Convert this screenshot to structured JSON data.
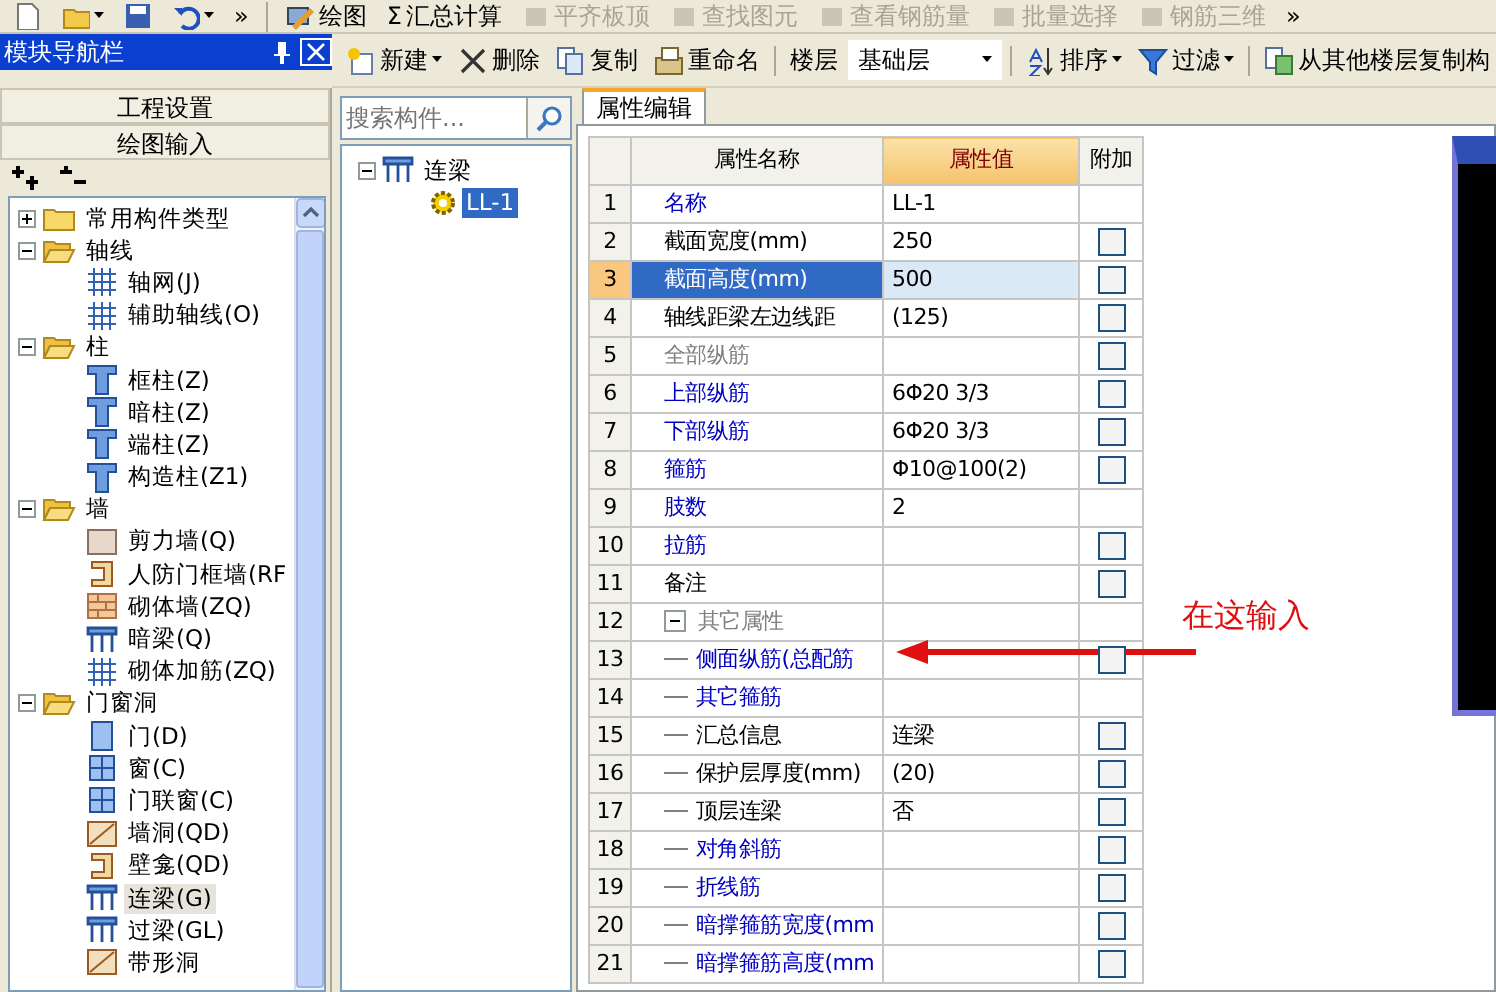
{
  "quick_access": [
    {
      "dropdown": false
    },
    {
      "dropdown": true
    },
    {
      "dropdown": false
    },
    {
      "dropdown": true
    }
  ],
  "quick_overflow": "»",
  "tools": [
    {
      "label": "绘图",
      "disabled": false
    },
    {
      "label": "汇总计算",
      "symbol": "Σ",
      "disabled": false
    },
    {
      "label": "平齐板顶",
      "disabled": true
    },
    {
      "label": "查找图元",
      "disabled": true
    },
    {
      "label": "查看钢筋量",
      "disabled": true
    },
    {
      "label": "批量选择",
      "disabled": true
    },
    {
      "label": "钢筋三维",
      "disabled": true
    }
  ],
  "tools_overflow": "»",
  "nav": {
    "title": "模块导航栏",
    "sections": [
      {
        "label": "工程设置"
      },
      {
        "label": "绘图输入"
      }
    ],
    "tree": [
      {
        "label": "常用构件类型",
        "expanded": false,
        "selected": false
      },
      {
        "label": "轴线",
        "expanded": true,
        "selected": false,
        "children": [
          {
            "label": "轴网(J)",
            "selected": false
          },
          {
            "label": "辅助轴线(O)",
            "selected": false
          }
        ]
      },
      {
        "label": "柱",
        "expanded": true,
        "selected": false,
        "children": [
          {
            "label": "框柱(Z)",
            "selected": false
          },
          {
            "label": "暗柱(Z)",
            "selected": false
          },
          {
            "label": "端柱(Z)",
            "selected": false
          },
          {
            "label": "构造柱(Z1)",
            "selected": false
          }
        ]
      },
      {
        "label": "墙",
        "expanded": true,
        "selected": false,
        "children": [
          {
            "label": "剪力墙(Q)",
            "selected": false
          },
          {
            "label": "人防门框墙(RF",
            "selected": false
          },
          {
            "label": "砌体墙(ZQ)",
            "selected": false
          },
          {
            "label": "暗梁(Q)",
            "selected": false
          },
          {
            "label": "砌体加筋(ZQ)",
            "selected": false
          }
        ]
      },
      {
        "label": "门窗洞",
        "expanded": true,
        "selected": false,
        "children": [
          {
            "label": "门(D)",
            "selected": false
          },
          {
            "label": "窗(C)",
            "selected": false
          },
          {
            "label": "门联窗(C)",
            "selected": false
          },
          {
            "label": "墙洞(QD)",
            "selected": false
          },
          {
            "label": "壁龛(QD)",
            "selected": false
          },
          {
            "label": "连梁(G)",
            "selected": true
          },
          {
            "label": "过梁(GL)",
            "selected": false
          },
          {
            "label": "带形洞",
            "selected": false
          }
        ]
      }
    ]
  },
  "toolbar": {
    "left": [
      {
        "label": "新建",
        "dropdown": true
      },
      {
        "label": "删除",
        "dropdown": false
      },
      {
        "label": "复制",
        "dropdown": false
      },
      {
        "label": "重命名",
        "dropdown": false
      }
    ],
    "floor": {
      "label": "楼层",
      "value": "基础层"
    },
    "right": [
      {
        "label": "排序",
        "dropdown": true
      },
      {
        "label": "过滤",
        "dropdown": true
      },
      {
        "label": "从其他楼层复制构",
        "dropdown": false
      }
    ]
  },
  "components": {
    "search": {
      "placeholder": "搜索构件..."
    },
    "tree": [
      {
        "label": "连梁",
        "expanded": true,
        "selected": false,
        "children": [
          {
            "label": "LL-1",
            "selected": true
          }
        ]
      }
    ]
  },
  "tabs": [
    {
      "label": "属性编辑",
      "selected": true
    }
  ],
  "table": {
    "columns": [
      "属性名称",
      "属性值",
      "附加"
    ],
    "rows": [
      {
        "index": "1",
        "name": "名称",
        "value": "LL-1",
        "color": "#0000c0",
        "selected": false
      },
      {
        "index": "2",
        "name": "截面宽度(mm)",
        "value": "250",
        "color": "#000000",
        "selected": false,
        "checked": false
      },
      {
        "index": "3",
        "name": "截面高度(mm)",
        "value": "500",
        "color": "#ffffff",
        "selected": true,
        "checked": false
      },
      {
        "index": "4",
        "name": "轴线距梁左边线距",
        "value": "(125)",
        "color": "#000000",
        "selected": false,
        "checked": false
      },
      {
        "index": "5",
        "name": "全部纵筋",
        "color": "#808080",
        "selected": false,
        "checked": false
      },
      {
        "index": "6",
        "name": "上部纵筋",
        "value": "6Φ20 3/3",
        "color": "#0000c0",
        "selected": false,
        "checked": false
      },
      {
        "index": "7",
        "name": "下部纵筋",
        "value": "6Φ20 3/3",
        "color": "#0000c0",
        "selected": false,
        "checked": false
      },
      {
        "index": "8",
        "name": "箍筋",
        "value": "Φ10@100(2)",
        "color": "#0000c0",
        "selected": false,
        "checked": false
      },
      {
        "index": "9",
        "name": "肢数",
        "value": "2",
        "color": "#0000c0",
        "selected": false
      },
      {
        "index": "10",
        "name": "拉筋",
        "color": "#0000c0",
        "selected": false,
        "checked": false
      },
      {
        "index": "11",
        "name": "备注",
        "color": "#000000",
        "selected": false,
        "checked": false
      },
      {
        "index": "12",
        "name": "其它属性",
        "color": "#808080",
        "selected": false,
        "expanded": true,
        "children": [
          {
            "index": "13",
            "name": "侧面纵筋(总配筋",
            "color": "#0000c0",
            "selected": false,
            "checked": false
          },
          {
            "index": "14",
            "name": "其它箍筋",
            "color": "#0000c0",
            "selected": false
          },
          {
            "index": "15",
            "name": "汇总信息",
            "value": "连梁",
            "color": "#000000",
            "selected": false,
            "checked": false
          },
          {
            "index": "16",
            "name": "保护层厚度(mm)",
            "value": "(20)",
            "color": "#000000",
            "selected": false,
            "checked": false
          },
          {
            "index": "17",
            "name": "顶层连梁",
            "value": "否",
            "color": "#000000",
            "selected": false,
            "checked": false
          },
          {
            "index": "18",
            "name": "对角斜筋",
            "color": "#0000c0",
            "selected": false,
            "checked": false
          },
          {
            "index": "19",
            "name": "折线筋",
            "color": "#0000c0",
            "selected": false,
            "checked": false
          },
          {
            "index": "20",
            "name": "暗撑箍筋宽度(mm",
            "color": "#0000c0",
            "selected": false,
            "checked": false
          },
          {
            "index": "21",
            "name": "暗撑箍筋高度(mm",
            "color": "#0000c0",
            "selected": false,
            "checked": false
          }
        ]
      }
    ]
  },
  "annotation": {
    "text": "在这输入"
  }
}
